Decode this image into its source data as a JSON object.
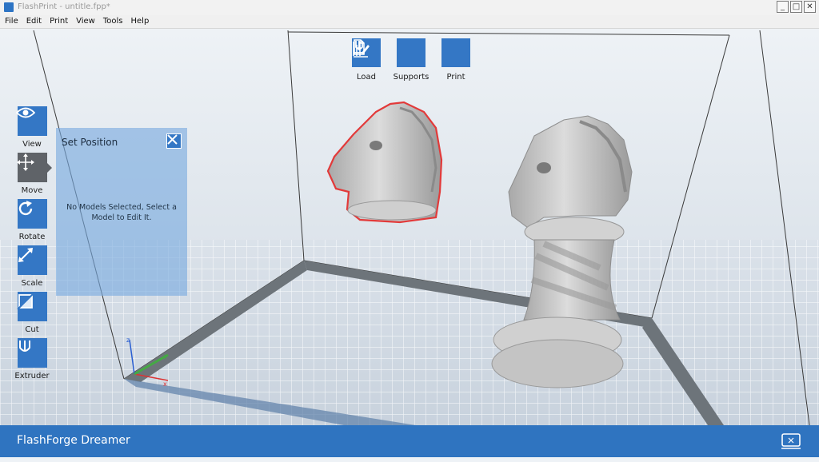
{
  "window": {
    "title": "FlashPrint - untitle.fpp*",
    "controls": [
      "_",
      "□",
      "✕"
    ]
  },
  "menu": [
    {
      "label": "File"
    },
    {
      "label": "Edit"
    },
    {
      "label": "Print"
    },
    {
      "label": "View"
    },
    {
      "label": "Tools"
    },
    {
      "label": "Help"
    }
  ],
  "top_toolbar": [
    {
      "label": "Load",
      "icon": "load-icon"
    },
    {
      "label": "Supports",
      "icon": "supports-icon"
    },
    {
      "label": "Print",
      "icon": "print-icon"
    }
  ],
  "left_toolbar": [
    {
      "label": "View",
      "icon": "eye-icon"
    },
    {
      "label": "Move",
      "icon": "move-icon",
      "active": true
    },
    {
      "label": "Rotate",
      "icon": "rotate-icon"
    },
    {
      "label": "Scale",
      "icon": "scale-icon"
    },
    {
      "label": "Cut",
      "icon": "cut-icon"
    },
    {
      "label": "Extruder",
      "icon": "extruder-icon"
    }
  ],
  "panel": {
    "title": "Set Position",
    "message": "No Models Selected, Select a Model to Edit It."
  },
  "axes": {
    "x_label": "x",
    "y_label": "y",
    "z_label": "z"
  },
  "status_bar": {
    "printer": "FlashForge Dreamer"
  },
  "colors": {
    "accent": "#3477c5",
    "active_tool": "#5f6368",
    "status_bar": "#2f74c0",
    "selection_outline": "#e23a3a"
  }
}
